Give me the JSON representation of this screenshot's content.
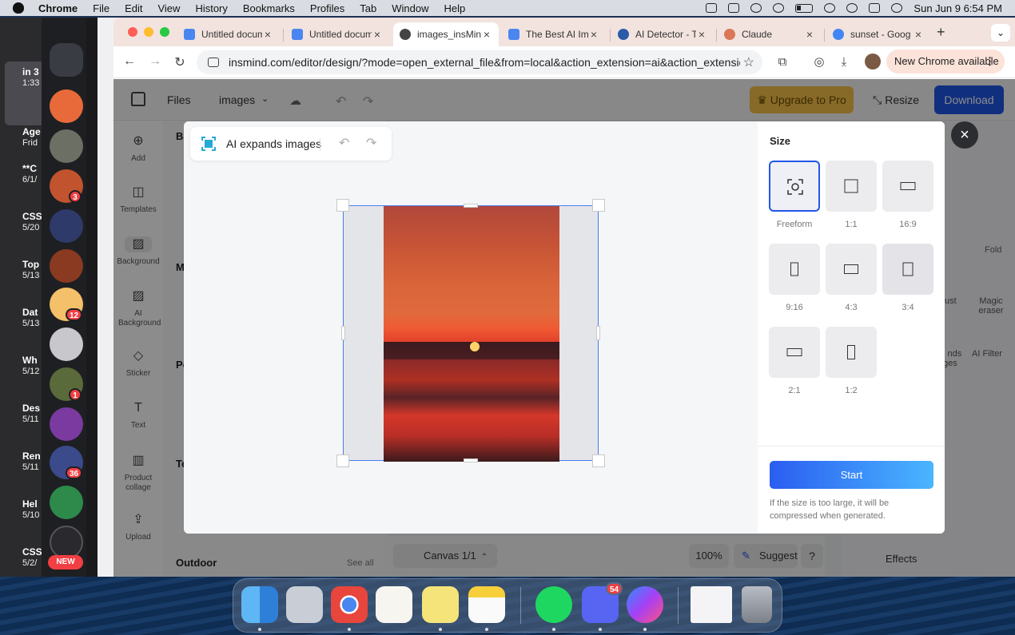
{
  "menubar": {
    "app": "Chrome",
    "items": [
      "File",
      "Edit",
      "View",
      "History",
      "Bookmarks",
      "Profiles",
      "Tab",
      "Window",
      "Help"
    ],
    "clock": "Sun Jun 9  6:54 PM"
  },
  "left_window": {
    "rows": [
      {
        "title": "in 3",
        "sub": "1:33"
      },
      {
        "title": "Age",
        "sub": "Frid"
      },
      {
        "title": "**C",
        "sub": "6/1/"
      },
      {
        "title": "CSS",
        "sub": "5/20"
      },
      {
        "title": "Top",
        "sub": "5/13"
      },
      {
        "title": "Dat",
        "sub": "5/13"
      },
      {
        "title": "Wh",
        "sub": "5/12"
      },
      {
        "title": "Des",
        "sub": "5/11"
      },
      {
        "title": "Ren",
        "sub": "5/11"
      },
      {
        "title": "Hel",
        "sub": "5/10"
      },
      {
        "title": "CSS",
        "sub": "5/2/"
      }
    ]
  },
  "discord": {
    "badges": [
      "3",
      "12",
      "1",
      "36"
    ],
    "new_label": "NEW"
  },
  "tabs": [
    {
      "label": "Untitled docum",
      "icon_color": "#4a86f0"
    },
    {
      "label": "Untitled docum",
      "icon_color": "#4a86f0"
    },
    {
      "label": "images_insMin",
      "icon_color": "#444444"
    },
    {
      "label": "The Best AI Ima",
      "icon_color": "#4a86f0"
    },
    {
      "label": "AI Detector - T",
      "icon_color": "#2a5aa8"
    },
    {
      "label": "Claude",
      "icon_color": "#d97757"
    },
    {
      "label": "sunset - Goog",
      "icon_color": "#4285f4"
    }
  ],
  "toolbar": {
    "url": "insmind.com/editor/design/?mode=open_external_file&from=local&action_extension=ai&action_extension_...",
    "new_chrome": "New Chrome available"
  },
  "app": {
    "files": "Files",
    "project": "images",
    "upgrade": "Upgrade to Pro",
    "resize": "Resize",
    "download": "Download",
    "sidebar": [
      {
        "label": "Add",
        "icon": "plus-circle-icon"
      },
      {
        "label": "Templates",
        "icon": "templates-icon"
      },
      {
        "label": "Background",
        "icon": "background-icon"
      },
      {
        "label": "AI Background",
        "icon": "ai-background-icon"
      },
      {
        "label": "Sticker",
        "icon": "sticker-icon"
      },
      {
        "label": "Text",
        "icon": "text-icon"
      },
      {
        "label": "Product collage",
        "icon": "collage-icon"
      },
      {
        "label": "Upload",
        "icon": "upload-icon"
      }
    ],
    "panel_headings": {
      "a": "Ba",
      "b": "M",
      "c": "Po",
      "d": "Te",
      "outdoor": "Outdoor",
      "see_all": "See all"
    },
    "canvas": "Canvas 1/1",
    "zoom": "100%",
    "suggest": "Suggest",
    "help": "?",
    "right": {
      "fold": "Fold",
      "tool1": "ust",
      "tool2": "Magic eraser",
      "tool3": "l nds ges",
      "tool4": "AI Filter",
      "effects": "Effects"
    }
  },
  "modal": {
    "title": "AI expands images",
    "size_label": "Size",
    "options": [
      {
        "label": "Freeform",
        "selected": true
      },
      {
        "label": "1:1"
      },
      {
        "label": "16:9"
      },
      {
        "label": "9:16"
      },
      {
        "label": "4:3"
      },
      {
        "label": "3:4"
      },
      {
        "label": "2:1"
      },
      {
        "label": "1:2"
      }
    ],
    "start": "Start",
    "note": "If the size is too large, it will be compressed when generated."
  },
  "dock": {
    "discord_badge": "54"
  }
}
